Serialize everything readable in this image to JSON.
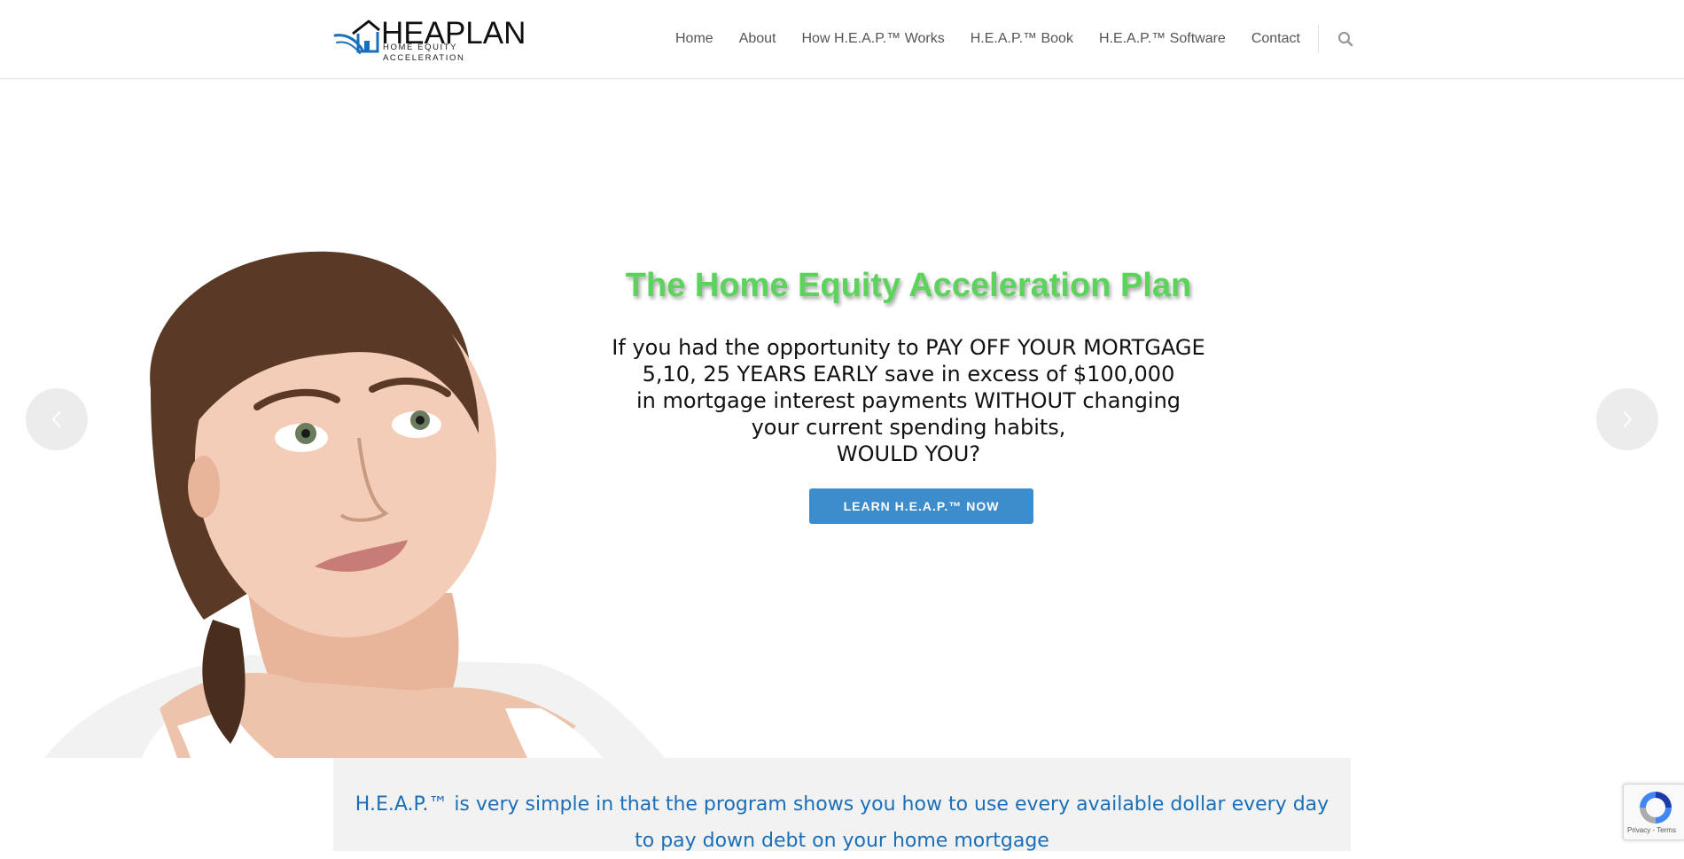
{
  "header": {
    "logo": {
      "name": "HEAPLAN",
      "tagline": "HOME EQUITY ACCELERATION",
      "accent_color": "#1a6fb8"
    },
    "nav": [
      {
        "label": "Home"
      },
      {
        "label": "About"
      },
      {
        "label": "How H.E.A.P.™ Works"
      },
      {
        "label": "H.E.A.P.™ Book"
      },
      {
        "label": "H.E.A.P.™ Software"
      },
      {
        "label": "Contact"
      }
    ],
    "search_icon": "search-icon"
  },
  "hero": {
    "title": "The Home Equity Acceleration Plan",
    "title_color": "#5cd45c",
    "copy_lines": [
      "If you had the opportunity to PAY OFF YOUR MORTGAGE",
      "5,10, 25 YEARS EARLY save in excess of $100,000",
      "in mortgage interest payments WITHOUT changing",
      "your current spending habits,",
      "WOULD YOU?"
    ],
    "cta_label": "LEARN H.E.A.P.™ NOW",
    "cta_color": "#3d8ccc",
    "prev_icon": "chevron-left-icon",
    "next_icon": "chevron-right-icon",
    "image": "woman-thinking-photo"
  },
  "info": {
    "text": "H.E.A.P.™ is very simple in that the program shows you how to use every available dollar every day to pay down debt on your home mortgage",
    "text_color": "#1a6fb8"
  },
  "recaptcha": {
    "terms": "Privacy - Terms"
  }
}
